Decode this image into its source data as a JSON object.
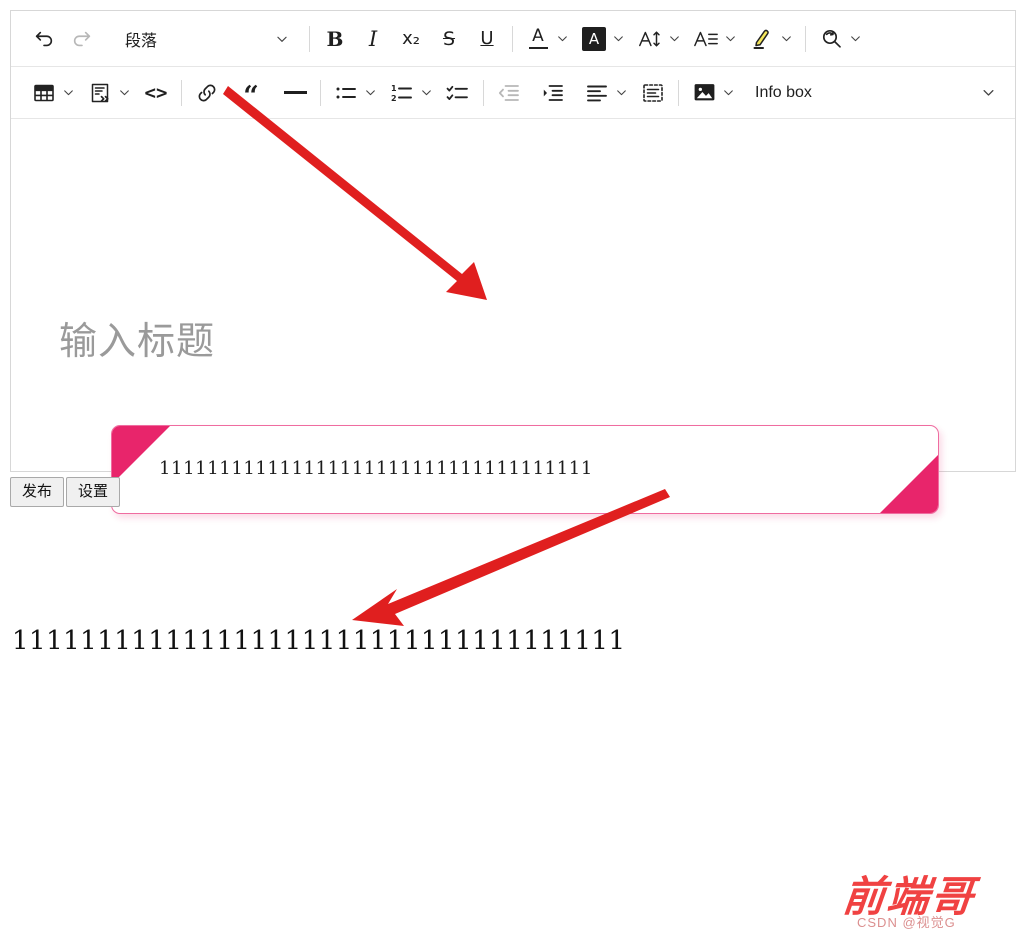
{
  "editor": {
    "toolbar_row1": {
      "undo_label": "undo",
      "redo_label": "redo",
      "paragraph_style": "段落",
      "bold_label": "B",
      "italic_label": "I",
      "subscript_label": "x₂",
      "strikethrough_label": "S",
      "underline_label": "U",
      "font_color_label": "A",
      "background_color_label": "A",
      "font_size_label": "A↕",
      "line_height_label": "A≡",
      "highlight_label": "highlighter",
      "find_replace_label": "find-replace"
    },
    "toolbar_row2": {
      "table_label": "table",
      "code_block_label": "code-block",
      "inline_code_label": "<>",
      "link_label": "link",
      "quote_label": "“",
      "divider_label": "—",
      "bullet_list_label": "bullet-list",
      "numbered_list_label": "numbered-list",
      "todo_list_label": "todo-list",
      "outdent_label": "outdent",
      "indent_label": "indent",
      "align_label": "align-left",
      "page_break_label": "page-break",
      "image_label": "image",
      "infobox_select_value": "Info box"
    },
    "title_placeholder": "输入标题",
    "infobox": {
      "text": "111111111111111111111111111111111111",
      "accent_color": "#e8256b",
      "border_color": "#ef6ca0"
    }
  },
  "buttons": {
    "publish": "发布",
    "settings": "设置"
  },
  "preview": {
    "text": "111111111111111111111111111111111111"
  },
  "annotations": {
    "arrow_color": "#e01f1f",
    "arrow1_desc": "arrow pointing from link button to info box",
    "arrow2_desc": "arrow pointing to rendered preview text"
  },
  "watermark": {
    "brand": "前端哥",
    "credit": "CSDN @视觉G",
    "color": "#ef3333"
  }
}
